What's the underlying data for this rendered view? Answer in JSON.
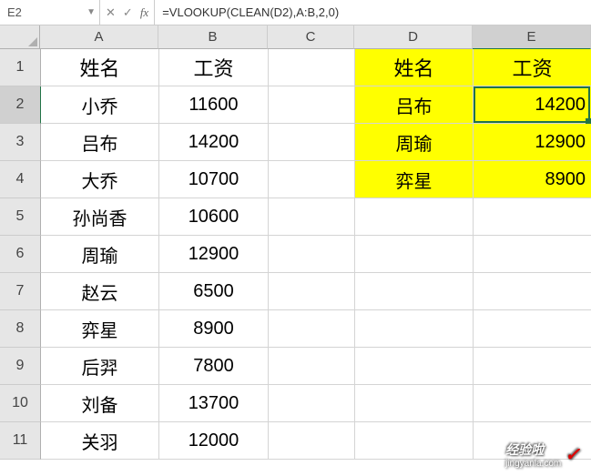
{
  "namebox": {
    "value": "E2"
  },
  "fx": {
    "cancel": "✕",
    "confirm": "✓",
    "label": "fx"
  },
  "formula": "=VLOOKUP(CLEAN(D2),A:B,2,0)",
  "columns": [
    "A",
    "B",
    "C",
    "D",
    "E"
  ],
  "rows": [
    "1",
    "2",
    "3",
    "4",
    "5",
    "6",
    "7",
    "8",
    "9",
    "10",
    "11"
  ],
  "activeCell": {
    "row": 1,
    "col": 4
  },
  "data": {
    "headers": {
      "name": "姓名",
      "salary": "工资"
    },
    "left": [
      {
        "name": "小乔",
        "salary": "11600"
      },
      {
        "name": "吕布",
        "salary": "14200"
      },
      {
        "name": "大乔",
        "salary": "10700"
      },
      {
        "name": "孙尚香",
        "salary": "10600"
      },
      {
        "name": "周瑜",
        "salary": "12900"
      },
      {
        "name": "赵云",
        "salary": "6500"
      },
      {
        "name": "弈星",
        "salary": "8900"
      },
      {
        "name": "后羿",
        "salary": "7800"
      },
      {
        "name": "刘备",
        "salary": "13700"
      },
      {
        "name": "关羽",
        "salary": "12000"
      }
    ],
    "right": [
      {
        "name": "吕布",
        "salary": "14200"
      },
      {
        "name": "周瑜",
        "salary": "12900"
      },
      {
        "name": "弈星",
        "salary": "8900"
      }
    ]
  },
  "watermark": {
    "text": "经验啦",
    "url": "jingyanla.com"
  }
}
